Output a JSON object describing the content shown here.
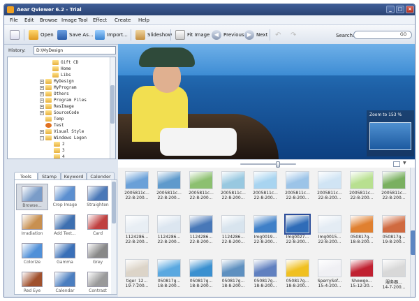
{
  "window": {
    "title": "Aear Qviewer 6.2 - Trial"
  },
  "menu": [
    "File",
    "Edit",
    "Browse",
    "Image Tool",
    "Effect",
    "Create",
    "Help"
  ],
  "toolbar": {
    "open": "Open",
    "save_as": "Save As...",
    "import": "Import...",
    "slideshow": "Slideshow",
    "fit_image": "Fit Image",
    "previous": "Previous",
    "next": "Next",
    "search_label": "Search:",
    "search_value": "",
    "go": "GO"
  },
  "history": {
    "label": "History:",
    "value": "D:\\MyDesign"
  },
  "tree": [
    {
      "label": "Gift CD",
      "expander": ""
    },
    {
      "label": "Home",
      "expander": ""
    },
    {
      "label": "Libs",
      "expander": ""
    },
    {
      "label": "MyDesign",
      "expander": "+"
    },
    {
      "label": "MyProgram",
      "expander": "+"
    },
    {
      "label": "Others",
      "expander": "+"
    },
    {
      "label": "Program Files",
      "expander": "+"
    },
    {
      "label": "ResImage",
      "expander": "+"
    },
    {
      "label": "SourceCode",
      "expander": "+"
    },
    {
      "label": "Temp",
      "expander": ""
    },
    {
      "label": "Test",
      "expander": ""
    },
    {
      "label": "Visual Style",
      "expander": "+"
    },
    {
      "label": "Windows Logon",
      "expander": "-"
    },
    {
      "label": "2",
      "expander": ""
    },
    {
      "label": "3",
      "expander": ""
    },
    {
      "label": "4",
      "expander": ""
    }
  ],
  "tabs": [
    "Tools",
    "Stamp",
    "Keyword",
    "Calender"
  ],
  "tools": [
    {
      "label": "Browse...",
      "color": "#7a9cc8"
    },
    {
      "label": "Crop Image",
      "color": "#5b8fd0"
    },
    {
      "label": "Straighten",
      "color": "#4a78b8"
    },
    {
      "label": "Irradiation",
      "color": "#c89050"
    },
    {
      "label": "Add Text...",
      "color": "#3d6fb0"
    },
    {
      "label": "Card",
      "color": "#c04040"
    },
    {
      "label": "Colorize",
      "color": "#5090d8"
    },
    {
      "label": "Gamma",
      "color": "#3a70b8"
    },
    {
      "label": "Grey",
      "color": "#888888"
    },
    {
      "label": "Red Eye",
      "color": "#a0502c"
    },
    {
      "label": "Calendar",
      "color": "#4b7ec0"
    },
    {
      "label": "Contrast",
      "color": "#9a9a9a"
    }
  ],
  "preview": {
    "zoom_label": "Zoom to 153 %"
  },
  "thumbnails": [
    {
      "name": "2005811c...",
      "date": "22-8-200...",
      "color": "#6aa0d8"
    },
    {
      "name": "2005811c...",
      "date": "22-8-200...",
      "color": "#5f9acc"
    },
    {
      "name": "2005811c...",
      "date": "22-8-200...",
      "color": "#8cc070"
    },
    {
      "name": "2005811c...",
      "date": "22-8-200...",
      "color": "#98c8e0"
    },
    {
      "name": "2005811c...",
      "date": "22-8-200...",
      "color": "#a8d4f0"
    },
    {
      "name": "2005811c...",
      "date": "22-8-200...",
      "color": "#9cc4e8"
    },
    {
      "name": "2005811c...",
      "date": "22-8-200...",
      "color": "#d0e4f4"
    },
    {
      "name": "2005811c...",
      "date": "22-8-200...",
      "color": "#b8e090"
    },
    {
      "name": "2005811c...",
      "date": "22-8-200...",
      "color": "#7ab060"
    },
    {
      "name": "1124286...",
      "date": "22-8-200...",
      "color": "#e8eef4"
    },
    {
      "name": "1124286...",
      "date": "22-8-200...",
      "color": "#dce6f0"
    },
    {
      "name": "1124286...",
      "date": "22-8-200...",
      "color": "#4878b8"
    },
    {
      "name": "1124286...",
      "date": "22-8-200...",
      "color": "#d8e4ee"
    },
    {
      "name": "Img0019...",
      "date": "22-8-200...",
      "color": "#3f80c8"
    },
    {
      "name": "Img0027...",
      "date": "22-8-200...",
      "color": "#2f6cb8"
    },
    {
      "name": "Img0015...",
      "date": "22-8-200...",
      "color": "#e4ecf4"
    },
    {
      "name": "050817g...",
      "date": "18-8-200...",
      "color": "#e08030"
    },
    {
      "name": "050817g...",
      "date": "19-8-200...",
      "color": "#d06a40"
    },
    {
      "name": "tiger_12...",
      "date": "19-7-200...",
      "color": "#dcd4c8"
    },
    {
      "name": "050817g...",
      "date": "18-8-200...",
      "color": "#5aa8e0"
    },
    {
      "name": "050817g...",
      "date": "18-8-200...",
      "color": "#3a90d0"
    },
    {
      "name": "050817g...",
      "date": "18-8-200...",
      "color": "#5e90c0"
    },
    {
      "name": "050817g...",
      "date": "18-8-200...",
      "color": "#6080c0"
    },
    {
      "name": "050817g...",
      "date": "18-8-200...",
      "color": "#f0c020"
    },
    {
      "name": "SperrySof...",
      "date": "15-4-200...",
      "color": "#f0f0f4"
    },
    {
      "name": "Showgo...",
      "date": "15-12-20...",
      "color": "#c02030"
    },
    {
      "name": "服务器...",
      "date": "14-7-200...",
      "color": "#d8d8d8"
    }
  ]
}
